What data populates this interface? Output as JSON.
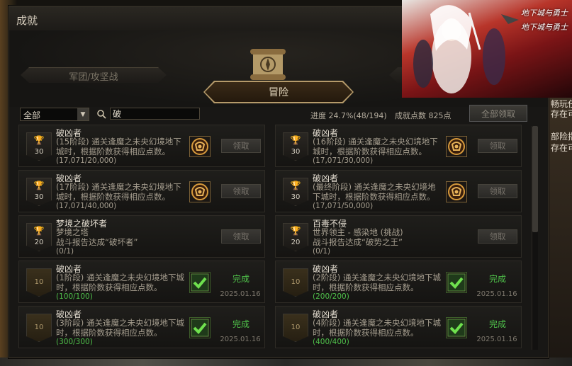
{
  "window": {
    "title": "成就"
  },
  "tabs": {
    "left": "军团/攻坚战",
    "active": "冒险"
  },
  "filter": {
    "selected": "全部"
  },
  "search": {
    "value": "破"
  },
  "stats": {
    "progress": "进度  24.7%(48/194)",
    "points": "成就点数 825点"
  },
  "claim_all": "全部领取",
  "banner": {
    "logo1": "地下城与勇士",
    "logo2": "地下城与勇士"
  },
  "side_text": [
    "畅玩任",
    "存在可",
    "部险指",
    "存在可"
  ],
  "cards": [
    {
      "badge": "30",
      "name": "破凶者",
      "desc": "(15阶段) 通关逢魔之未央幻境地下城时，根据阶数获得相应点数。",
      "progress": "(17,071/20,000)",
      "button": "领取",
      "status": "incomplete"
    },
    {
      "badge": "30",
      "name": "破凶者",
      "desc": "(16阶段) 通关逢魔之未央幻境地下城时，根据阶数获得相应点数。",
      "progress": "(17,071/30,000)",
      "button": "领取",
      "status": "incomplete"
    },
    {
      "badge": "30",
      "name": "破凶者",
      "desc": "(17阶段) 通关逢魔之未央幻境地下城时，根据阶数获得相应点数。",
      "progress": "(17,071/40,000)",
      "button": "领取",
      "status": "incomplete"
    },
    {
      "badge": "30",
      "name": "破凶者",
      "desc": "(最终阶段) 通关逢魔之未央幻境地下城时，根据阶数获得相应点数。",
      "progress": "(17,071/50,000)",
      "button": "领取",
      "status": "incomplete"
    },
    {
      "badge": "20",
      "name": "梦境之破坏者",
      "desc": "梦境之塔\n战斗报告达成“破坏者”",
      "progress": "(0/1)",
      "button": "领取",
      "status": "incomplete"
    },
    {
      "badge": "20",
      "name": "百毒不侵",
      "desc": "世界领主 - 感染地 (挑战)\n战斗报告达成“破势之王”",
      "progress": "(0/1)",
      "button": "领取",
      "status": "incomplete"
    },
    {
      "badge": "10",
      "name": "破凶者",
      "desc": "(1阶段) 通关逢魔之未央幻境地下城时，根据阶数获得相应点数。",
      "progress": "(100/100)",
      "complete": "完成",
      "date": "2025.01.16",
      "status": "done"
    },
    {
      "badge": "10",
      "name": "破凶者",
      "desc": "(2阶段) 通关逢魔之未央幻境地下城时，根据阶数获得相应点数。",
      "progress": "(200/200)",
      "complete": "完成",
      "date": "2025.01.16",
      "status": "done"
    },
    {
      "badge": "10",
      "name": "破凶者",
      "desc": "(3阶段) 通关逢魔之未央幻境地下城时，根据阶数获得相应点数。",
      "progress": "(300/300)",
      "complete": "完成",
      "date": "2025.01.16",
      "status": "done"
    },
    {
      "badge": "10",
      "name": "破凶者",
      "desc": "(4阶段) 通关逢魔之未央幻境地下城时，根据阶数获得相应点数。",
      "progress": "(400/400)",
      "complete": "完成",
      "date": "2025.01.16",
      "status": "done"
    }
  ]
}
